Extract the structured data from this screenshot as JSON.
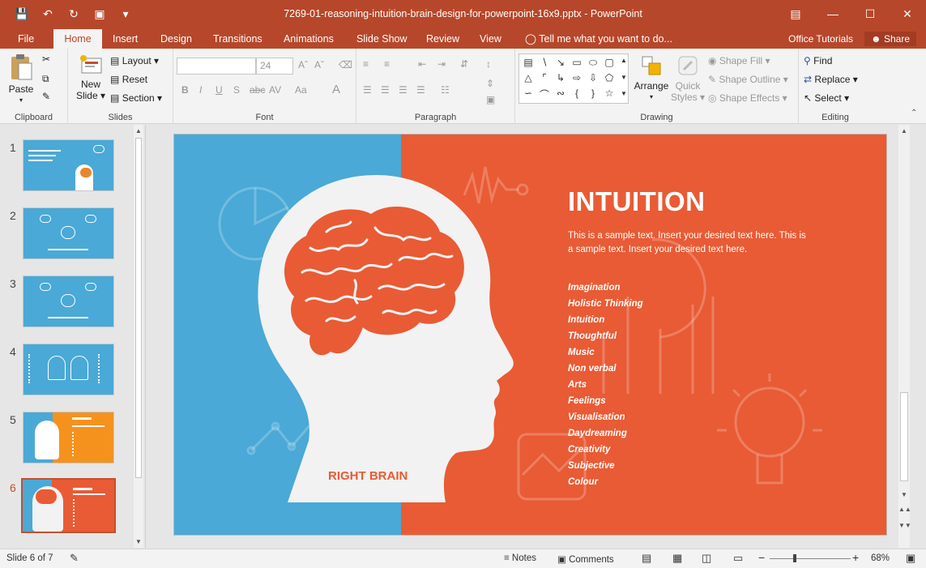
{
  "titlebar": {
    "doc_title": "7269-01-reasoning-intuition-brain-design-for-powerpoint-16x9.pptx - PowerPoint",
    "qat": [
      "save-icon",
      "undo-icon",
      "redo-icon",
      "present-icon",
      "customize-icon"
    ]
  },
  "tabs": [
    {
      "label": "File"
    },
    {
      "label": "Home"
    },
    {
      "label": "Insert"
    },
    {
      "label": "Design"
    },
    {
      "label": "Transitions"
    },
    {
      "label": "Animations"
    },
    {
      "label": "Slide Show"
    },
    {
      "label": "Review"
    },
    {
      "label": "View"
    }
  ],
  "tell_me": "Tell me what you want to do...",
  "office_tutorials": "Office Tutorials",
  "share": "Share",
  "ribbon": {
    "clipboard": {
      "paste": "Paste",
      "label": "Clipboard"
    },
    "slides": {
      "new_slide_1": "New",
      "new_slide_2": "Slide",
      "layout": "Layout",
      "reset": "Reset",
      "section": "Section",
      "label": "Slides"
    },
    "font": {
      "font_size": "24",
      "label": "Font"
    },
    "paragraph": {
      "label": "Paragraph"
    },
    "drawing": {
      "arrange": "Arrange",
      "quick_styles_1": "Quick",
      "quick_styles_2": "Styles",
      "shape_fill": "Shape Fill",
      "shape_outline": "Shape Outline",
      "shape_effects": "Shape Effects",
      "label": "Drawing"
    },
    "editing": {
      "find": "Find",
      "replace": "Replace",
      "select": "Select",
      "label": "Editing"
    }
  },
  "thumbnails": [
    {
      "num": "1",
      "theme": "blue"
    },
    {
      "num": "2",
      "theme": "blue"
    },
    {
      "num": "3",
      "theme": "blue"
    },
    {
      "num": "4",
      "theme": "blue"
    },
    {
      "num": "5",
      "theme": "orange"
    },
    {
      "num": "6",
      "theme": "red",
      "selected": true
    }
  ],
  "slide": {
    "heading": "INTUITION",
    "body": "This is a sample text. Insert your desired text  here. This is a sample text. Insert your desired text here.",
    "items": [
      "Imagination",
      "Holistic Thinking",
      "Intuition",
      "Thoughtful",
      "Music",
      "Non verbal",
      "Arts",
      "Feelings",
      "Visualisation",
      "Daydreaming",
      "Creativity",
      "Subjective",
      "Colour"
    ],
    "brain_label": "RIGHT BRAIN",
    "colors": {
      "left_bg": "#4aa9d6",
      "right_bg": "#e85b35",
      "head": "#f2f2f2"
    }
  },
  "status": {
    "slide_of": "Slide 6 of 7",
    "notes": "Notes",
    "comments": "Comments",
    "zoom": "68%"
  },
  "accent_color": "#b7472a"
}
